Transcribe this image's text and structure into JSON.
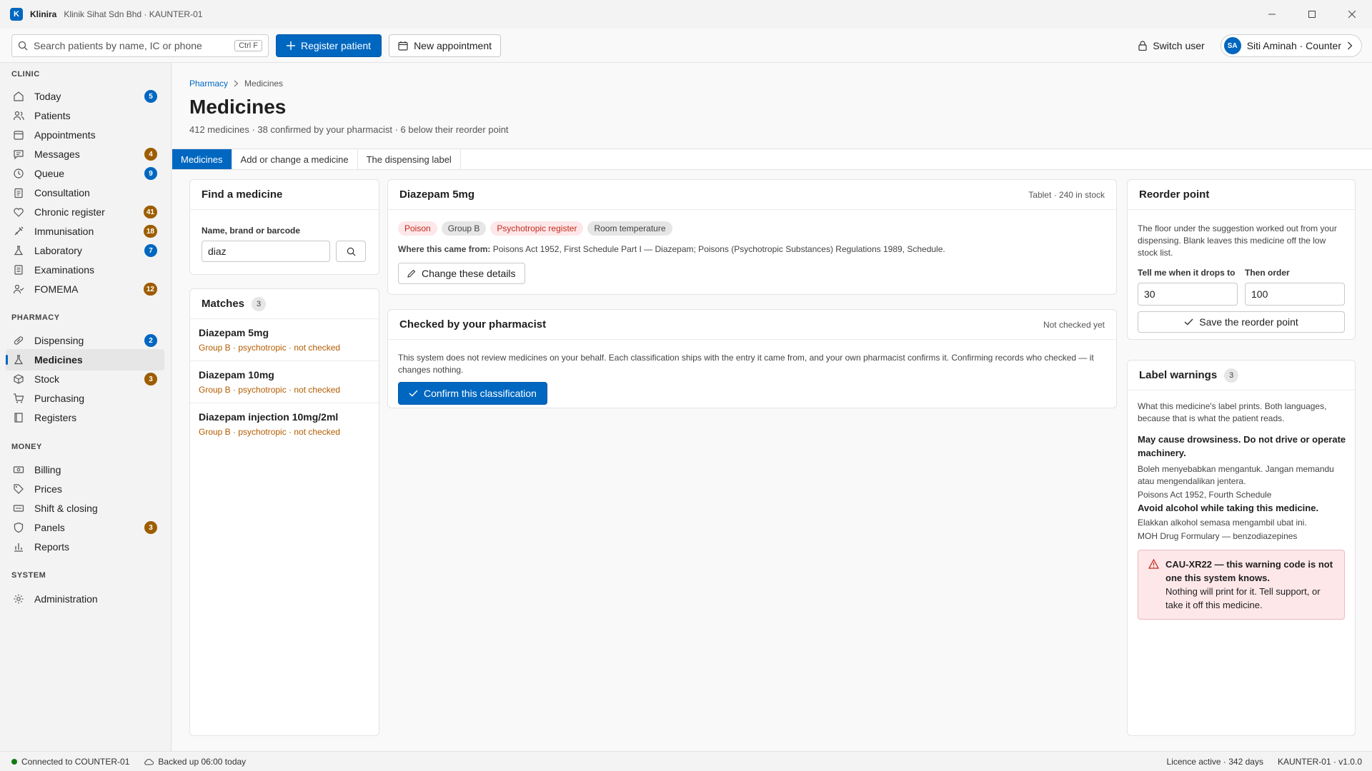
{
  "window": {
    "app_logo": "K",
    "app_name": "Klinira",
    "subtitle": "Klinik Sihat Sdn Bhd · KAUNTER-01",
    "controls": [
      "minimize-icon",
      "maximize-icon",
      "close-icon"
    ]
  },
  "toolbar": {
    "search_placeholder": "Search patients by name, IC or phone",
    "search_shortcut": "Ctrl F",
    "register_label": "Register patient",
    "appointment_label": "New appointment",
    "switch_user_label": "Switch user",
    "user_initials": "SA",
    "user_label": "Siti Aminah · Counter"
  },
  "sidebar": {
    "sections": [
      {
        "title": "CLINIC",
        "items": [
          {
            "label": "Today",
            "icon": "home-icon",
            "badge": "5",
            "badge_color": "blue"
          },
          {
            "label": "Patients",
            "icon": "people-icon",
            "badge": "",
            "badge_color": ""
          },
          {
            "label": "Appointments",
            "icon": "calendar-icon",
            "badge": "",
            "badge_color": ""
          },
          {
            "label": "Messages",
            "icon": "chat-icon",
            "badge": "4",
            "badge_color": "brown"
          },
          {
            "label": "Queue",
            "icon": "clock-icon",
            "badge": "9",
            "badge_color": "blue"
          },
          {
            "label": "Consultation",
            "icon": "clipboard-icon",
            "badge": "",
            "badge_color": ""
          },
          {
            "label": "Chronic register",
            "icon": "heart-icon",
            "badge": "41",
            "badge_color": "brown"
          },
          {
            "label": "Immunisation",
            "icon": "syringe-icon",
            "badge": "18",
            "badge_color": "brown"
          },
          {
            "label": "Laboratory",
            "icon": "flask-icon",
            "badge": "7",
            "badge_color": "blue"
          },
          {
            "label": "Examinations",
            "icon": "document-icon",
            "badge": "",
            "badge_color": ""
          },
          {
            "label": "FOMEMA",
            "icon": "person-check-icon",
            "badge": "12",
            "badge_color": "brown"
          }
        ]
      },
      {
        "title": "PHARMACY",
        "items": [
          {
            "label": "Dispensing",
            "icon": "pill-icon",
            "badge": "2",
            "badge_color": "blue"
          },
          {
            "label": "Medicines",
            "icon": "flask-icon",
            "badge": "",
            "badge_color": "",
            "active": true
          },
          {
            "label": "Stock",
            "icon": "box-icon",
            "badge": "3",
            "badge_color": "brown"
          },
          {
            "label": "Purchasing",
            "icon": "cart-icon",
            "badge": "",
            "badge_color": ""
          },
          {
            "label": "Registers",
            "icon": "book-icon",
            "badge": "",
            "badge_color": ""
          }
        ]
      },
      {
        "title": "MONEY",
        "items": [
          {
            "label": "Billing",
            "icon": "money-icon",
            "badge": "",
            "badge_color": ""
          },
          {
            "label": "Prices",
            "icon": "tag-icon",
            "badge": "",
            "badge_color": ""
          },
          {
            "label": "Shift & closing",
            "icon": "cash-icon",
            "badge": "",
            "badge_color": ""
          },
          {
            "label": "Panels",
            "icon": "shield-icon",
            "badge": "3",
            "badge_color": "brown"
          },
          {
            "label": "Reports",
            "icon": "bar-chart-icon",
            "badge": "",
            "badge_color": ""
          }
        ]
      },
      {
        "title": "SYSTEM",
        "items": [
          {
            "label": "Administration",
            "icon": "gear-icon",
            "badge": "",
            "badge_color": ""
          }
        ]
      }
    ]
  },
  "page": {
    "breadcrumb": {
      "parent": "Pharmacy",
      "current": "Medicines"
    },
    "title": "Medicines",
    "subtitle": "412 medicines · 38 confirmed by your pharmacist · 6 below their reorder point",
    "tabs": [
      "Medicines",
      "Add or change a medicine",
      "The dispensing label"
    ]
  },
  "find": {
    "title": "Find a medicine",
    "field_label": "Name, brand or barcode",
    "value": "diaz"
  },
  "matches": {
    "title": "Matches",
    "count": "3",
    "items": [
      {
        "name": "Diazepam 5mg",
        "meta": "Group B · psychotropic · not checked"
      },
      {
        "name": "Diazepam 10mg",
        "meta": "Group B · psychotropic · not checked"
      },
      {
        "name": "Diazepam injection 10mg/2ml",
        "meta": "Group B · psychotropic · not checked"
      }
    ]
  },
  "detail": {
    "title": "Diazepam 5mg",
    "meta": "Tablet · 240 in stock",
    "pills": [
      {
        "label": "Poison",
        "tone": "red"
      },
      {
        "label": "Group B",
        "tone": "grey"
      },
      {
        "label": "Psychotropic register",
        "tone": "red"
      },
      {
        "label": "Room temperature",
        "tone": "grey"
      }
    ],
    "source_label": "Where this came from:",
    "source_text": "Poisons Act 1952, First Schedule Part I — Diazepam; Poisons (Psychotropic Substances) Regulations 1989, Schedule.",
    "change_label": "Change these details"
  },
  "pharmacist": {
    "title": "Checked by your pharmacist",
    "status": "Not checked yet",
    "body": "This system does not review medicines on your behalf. Each classification ships with the entry it came from, and your own pharmacist confirms it. Confirming records who checked — it changes nothing.",
    "confirm_label": "Confirm this classification"
  },
  "reorder": {
    "title": "Reorder point",
    "help": "The floor under the suggestion worked out from your dispensing. Blank leaves this medicine off the low stock list.",
    "drop_label": "Tell me when it drops to",
    "drop_value": "30",
    "order_label": "Then order",
    "order_value": "100",
    "save_label": "Save the reorder point"
  },
  "warnings": {
    "title": "Label warnings",
    "count": "3",
    "intro": "What this medicine's label prints. Both languages, because that is what the patient reads.",
    "items": [
      {
        "en": "May cause drowsiness. Do not drive or operate machinery.",
        "ms": "Boleh menyebabkan mengantuk. Jangan memandu atau mengendalikan jentera.",
        "source": "Poisons Act 1952, Fourth Schedule"
      },
      {
        "en": "Avoid alcohol while taking this medicine.",
        "ms": "Elakkan alkohol semasa mengambil ubat ini.",
        "source": "MOH Drug Formulary — benzodiazepines"
      }
    ],
    "alert_title": "CAU-XR22 — this warning code is not one this system knows.",
    "alert_body": "Nothing will print for it. Tell support, or take it off this medicine."
  },
  "status": {
    "connected": "Connected to COUNTER-01",
    "connected_color": "#107c10",
    "backup": "Backed up 06:00 today",
    "licence": "Licence active · 342 days",
    "version": "KAUNTER-01 · v1.0.0"
  },
  "colors": {
    "accent": "#0067c0",
    "badge_brown": "#9d5d00",
    "danger": "#c42b1c"
  }
}
